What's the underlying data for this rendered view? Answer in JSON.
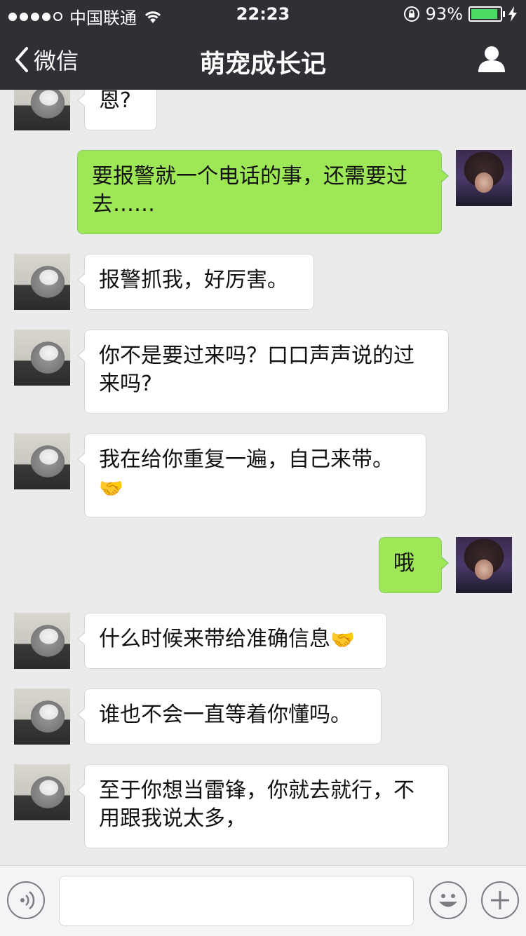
{
  "status_bar": {
    "carrier": "中国联通",
    "signal_bars": 4,
    "signal_max": 5,
    "time": "22:23",
    "battery_percent": "93%",
    "battery_level": 0.93
  },
  "nav": {
    "back_label": "微信",
    "title": "萌宠成长记",
    "user_icon": "person-icon"
  },
  "messages": [
    {
      "side": "left",
      "text": "恩?",
      "emoji": ""
    },
    {
      "side": "right",
      "text": "要报警就一个电话的事，还需要过去……",
      "emoji": ""
    },
    {
      "side": "left",
      "text": "报警抓我，好厉害。",
      "emoji": ""
    },
    {
      "side": "left",
      "text": "你不是要过来吗？口口声声说的过来吗?",
      "emoji": ""
    },
    {
      "side": "left",
      "text": "我在给你重复一遍，自己来带。",
      "emoji": "🤝"
    },
    {
      "side": "right",
      "text": "哦",
      "emoji": ""
    },
    {
      "side": "left",
      "text": "什么时候来带给准确信息",
      "emoji": "🤝"
    },
    {
      "side": "left",
      "text": "谁也不会一直等着你懂吗。",
      "emoji": ""
    },
    {
      "side": "left",
      "text": "至于你想当雷锋，你就去就行，不用跟我说太多，",
      "emoji": ""
    }
  ],
  "input_bar": {
    "voice_icon": "voice-icon",
    "input_value": "",
    "emoji_icon": "smiley-icon",
    "plus_icon": "plus-icon"
  },
  "colors": {
    "nav_bg": "#2f3035",
    "chat_bg": "#ebebeb",
    "sent_bubble": "#9ee757",
    "received_bubble": "#ffffff",
    "battery_green": "#4cd964"
  }
}
